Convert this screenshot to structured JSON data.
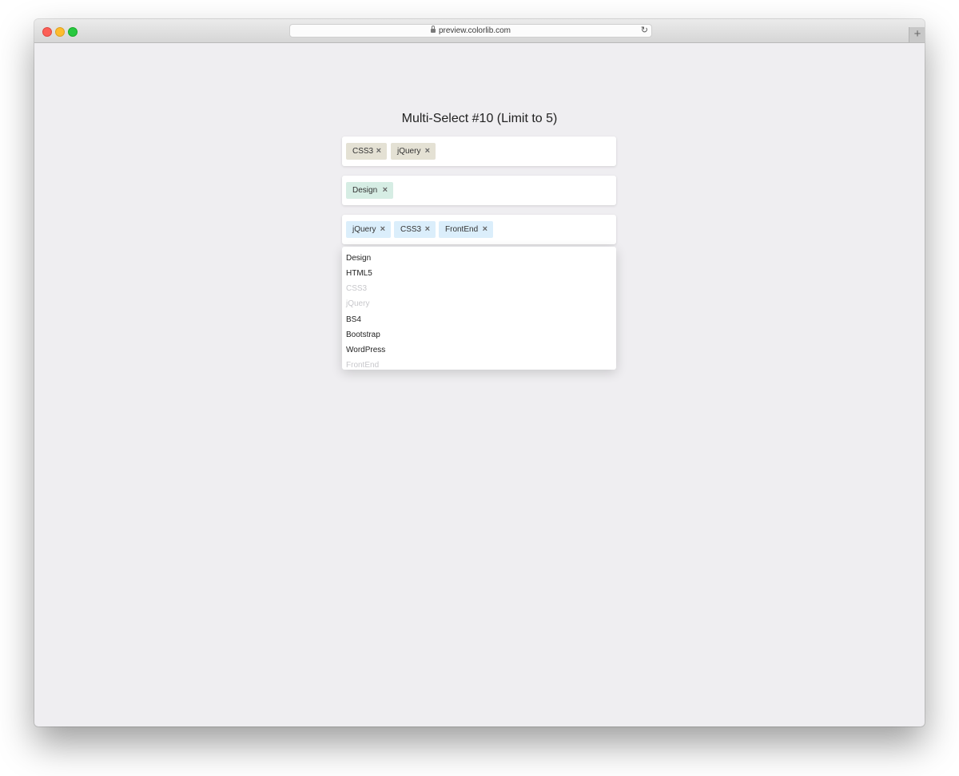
{
  "browser": {
    "url": "preview.colorlib.com"
  },
  "heading": "Multi-Select #10 (Limit to 5)",
  "selects": [
    {
      "tags": [
        "CSS3",
        "jQuery"
      ]
    },
    {
      "tags": [
        "Design"
      ]
    },
    {
      "tags": [
        "jQuery",
        "CSS3",
        "FrontEnd"
      ]
    }
  ],
  "dropdown": {
    "options": [
      {
        "label": "Design",
        "disabled": false
      },
      {
        "label": "HTML5",
        "disabled": false
      },
      {
        "label": "CSS3",
        "disabled": true
      },
      {
        "label": "jQuery",
        "disabled": true
      },
      {
        "label": "BS4",
        "disabled": false
      },
      {
        "label": "Bootstrap",
        "disabled": false
      },
      {
        "label": "WordPress",
        "disabled": false
      },
      {
        "label": "FrontEnd",
        "disabled": true
      }
    ]
  },
  "colors": {
    "tag_tan": "#e4e1d4",
    "tag_mint": "#d6ede4",
    "tag_blue": "#dbeefb",
    "disabled_text": "#c7c7cb"
  },
  "icons": {
    "remove": "×",
    "reload": "↻",
    "new_tab": "+"
  }
}
